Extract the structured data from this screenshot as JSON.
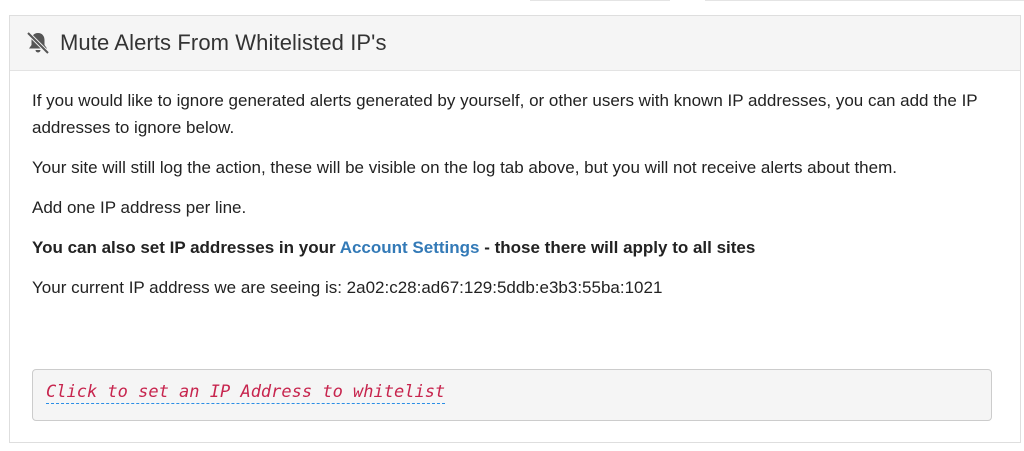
{
  "panel": {
    "title": "Mute Alerts From Whitelisted IP's",
    "icon": "bell-slash-icon"
  },
  "body": {
    "para1": "If you would like to ignore generated alerts generated by yourself, or other users with known IP addresses, you can add the IP addresses to ignore below.",
    "para2": "Your site will still log the action, these will be visible on the log tab above, but you will not receive alerts about them.",
    "para3": "Add one IP address per line.",
    "para4_prefix": "You can also set IP addresses in your ",
    "para4_link": "Account Settings",
    "para4_suffix": " - those there will apply to all sites",
    "ip_line": "Your current IP address we are seeing is: 2a02:c28:ad67:129:5ddb:e3b3:55ba:1021"
  },
  "editable": {
    "placeholder": "Click to set an IP Address to whitelist"
  },
  "colors": {
    "link": "#337ab7",
    "placeholder_text": "#c7254e",
    "placeholder_underline": "#2a8ee6"
  }
}
